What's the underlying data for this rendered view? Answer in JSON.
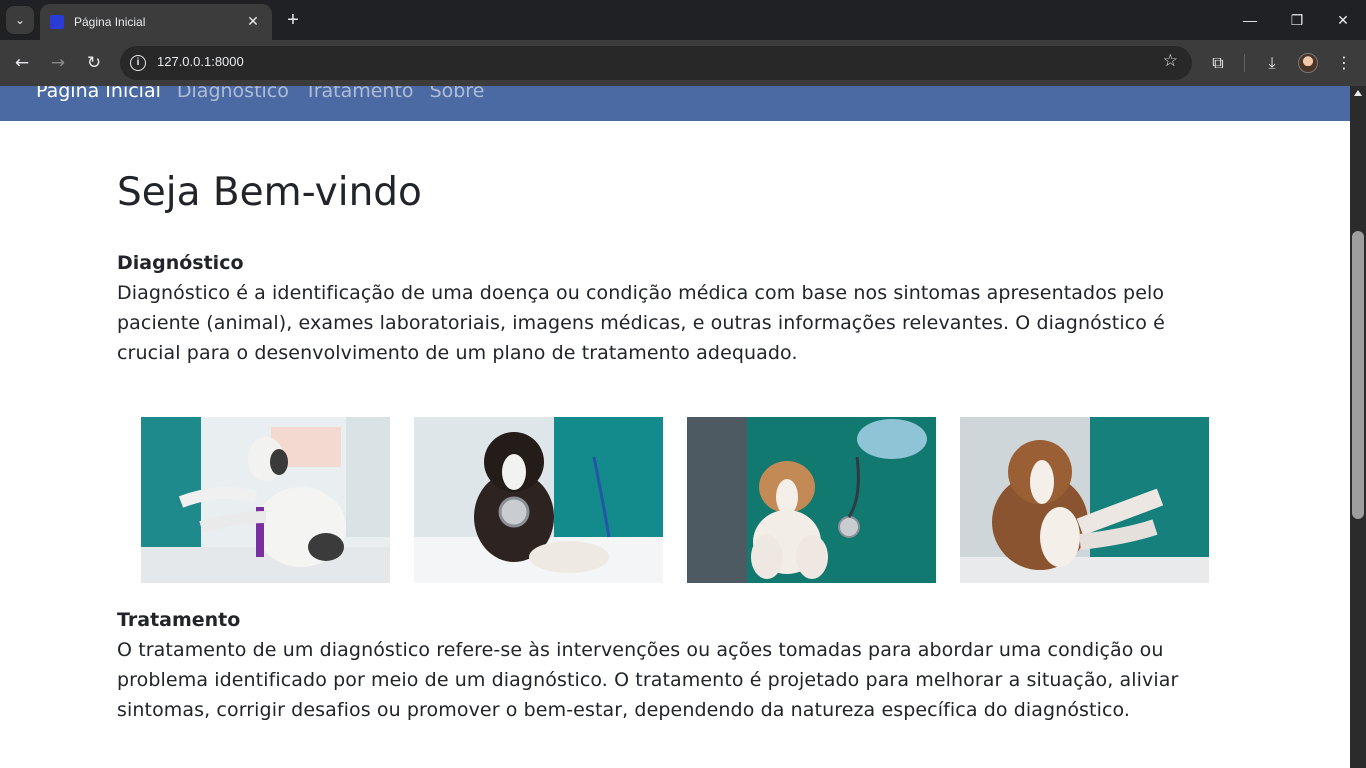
{
  "browser": {
    "tab_title": "Página Inicial",
    "tab_close": "✕",
    "new_tab": "+",
    "url": "127.0.0.1:8000",
    "info_glyph": "i",
    "window_controls": {
      "minimize": "—",
      "restore": "❐",
      "close": "✕"
    },
    "icons": [
      "tab-search-icon",
      "back-icon",
      "forward-icon",
      "reload-icon",
      "site-info-icon",
      "bookmark-star-icon",
      "extensions-icon",
      "downloads-icon",
      "profile-avatar",
      "menu-icon"
    ]
  },
  "navbar": {
    "items": [
      {
        "label": "Página Inicial",
        "active": true
      },
      {
        "label": "Diagnóstico",
        "active": false
      },
      {
        "label": "Tratamento",
        "active": false
      },
      {
        "label": "Sobre",
        "active": false
      }
    ],
    "color": "#4b69a3"
  },
  "main": {
    "heading": "Seja Bem-vindo",
    "diagnostico": {
      "title": "Diagnóstico",
      "text": "Diagnóstico é a identificação de uma doença ou condição médica com base nos sintomas apresentados pelo paciente (animal), exames laboratoriais, imagens médicas, e outras informações relevantes. O diagnóstico é crucial para o desenvolvimento de um plano de tratamento adequado."
    },
    "gallery": [
      {
        "alt": "vet-with-dog-photo"
      },
      {
        "alt": "puppy-with-stethoscope-photo"
      },
      {
        "alt": "vet-holding-beagle-puppy-photo"
      },
      {
        "alt": "puppy-paw-exam-photo"
      }
    ],
    "tratamento": {
      "title": "Tratamento",
      "text": "O tratamento de um diagnóstico refere-se às intervenções ou ações tomadas para abordar uma condição ou problema identificado por meio de um diagnóstico. O tratamento é projetado para melhorar a situação, aliviar sintomas, corrigir desafios ou promover o bem-estar, dependendo da natureza específica do diagnóstico."
    }
  }
}
